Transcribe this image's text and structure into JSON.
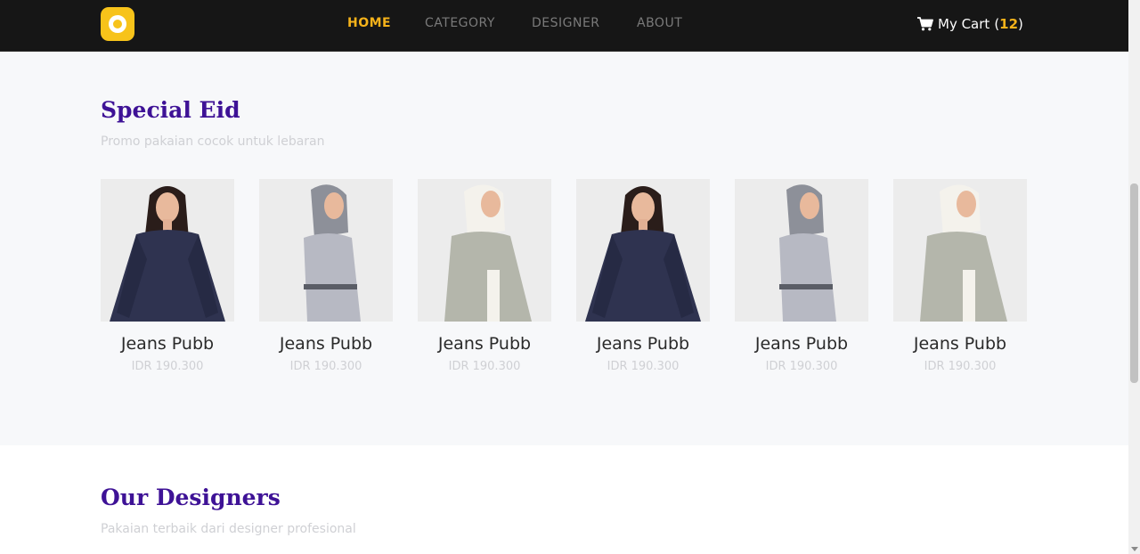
{
  "brand": {
    "logo_icon": "ring-logo-icon",
    "color": "#f7c31a"
  },
  "nav": {
    "items": [
      {
        "label": "HOME",
        "active": true
      },
      {
        "label": "CATEGORY",
        "active": false
      },
      {
        "label": "DESIGNER",
        "active": false
      },
      {
        "label": "ABOUT",
        "active": false
      }
    ],
    "active_color": "#f5b21a"
  },
  "cart": {
    "icon": "shopping-cart-icon",
    "label": "My Cart",
    "open_paren": "(",
    "count": "12",
    "close_paren": ")"
  },
  "special": {
    "title": "Special Eid",
    "subtitle": "Promo pakaian cocok untuk lebaran",
    "products": [
      {
        "name": "Jeans Pubb",
        "price": "IDR 190.300",
        "image": "navy-dress-model"
      },
      {
        "name": "Jeans Pubb",
        "price": "IDR 190.300",
        "image": "grey-hijab-dress-model"
      },
      {
        "name": "Jeans Pubb",
        "price": "IDR 190.300",
        "image": "sage-hijab-dress-model"
      },
      {
        "name": "Jeans Pubb",
        "price": "IDR 190.300",
        "image": "navy-dress-model"
      },
      {
        "name": "Jeans Pubb",
        "price": "IDR 190.300",
        "image": "grey-hijab-dress-model"
      },
      {
        "name": "Jeans Pubb",
        "price": "IDR 190.300",
        "image": "sage-hijab-dress-model"
      }
    ]
  },
  "designers": {
    "title": "Our Designers",
    "subtitle": "Pakaian terbaik dari designer profesional"
  },
  "colors": {
    "title": "#3e1296",
    "navbar": "#161616",
    "section_bg": "#f7f8fa"
  }
}
